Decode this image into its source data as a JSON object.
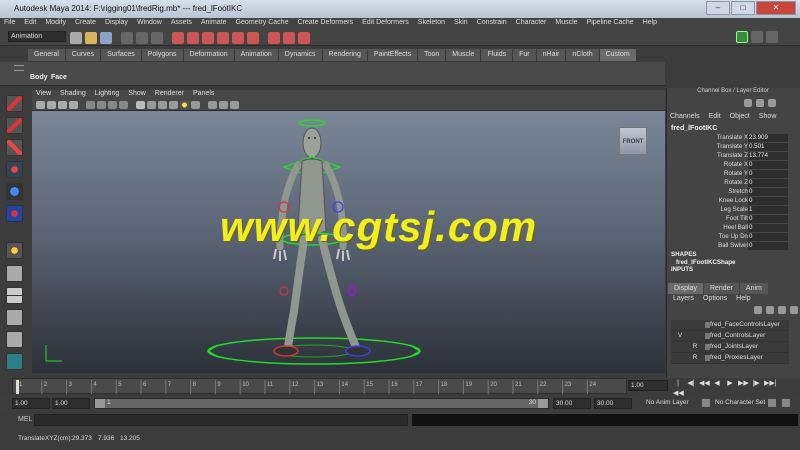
{
  "window": {
    "title": "Autodesk Maya 2014: F:\\rigging01\\fredRig.mb* --- fred_lFootIKC",
    "minimize": "–",
    "maximize": "□",
    "close": "✕"
  },
  "menu": [
    "File",
    "Edit",
    "Modify",
    "Create",
    "Display",
    "Window",
    "Assets",
    "Animate",
    "Geometry Cache",
    "Create Deformers",
    "Edit Deformers",
    "Skeleton",
    "Skin",
    "Constrain",
    "Character",
    "Muscle",
    "Pipeline Cache",
    "Help"
  ],
  "status_line": {
    "mode": "Animation"
  },
  "shelf_tabs": [
    "General",
    "Curves",
    "Surfaces",
    "Polygons",
    "Deformation",
    "Animation",
    "Dynamics",
    "Rendering",
    "PaintEffects",
    "Toon",
    "Muscle",
    "Fluids",
    "Fur",
    "nHair",
    "nCloth",
    "Custom"
  ],
  "shelf_active": "Custom",
  "shelf_items": [
    "Body",
    "Face"
  ],
  "panel_menu": [
    "View",
    "Shading",
    "Lighting",
    "Show",
    "Renderer",
    "Panels"
  ],
  "viewport": {
    "camera_label": "FRONT",
    "watermark": "www.cgtsj.com"
  },
  "channel_box": {
    "title": "Channel Box / Layer Editor",
    "menu": [
      "Channels",
      "Edit",
      "Object",
      "Show"
    ],
    "object": "fred_lFootIKC",
    "attributes": [
      {
        "name": "Translate X",
        "value": "23.909"
      },
      {
        "name": "Translate Y",
        "value": "0.501"
      },
      {
        "name": "Translate Z",
        "value": "13.774"
      },
      {
        "name": "Rotate X",
        "value": "0"
      },
      {
        "name": "Rotate Y",
        "value": "0"
      },
      {
        "name": "Rotate Z",
        "value": "0"
      },
      {
        "name": "Stretch",
        "value": "0"
      },
      {
        "name": "Knee Lock",
        "value": "0"
      },
      {
        "name": "Leg Scale",
        "value": "1"
      },
      {
        "name": "Foot Tilt",
        "value": "0"
      },
      {
        "name": "Heel Ball",
        "value": "0"
      },
      {
        "name": "Toe Up Dn",
        "value": "0"
      },
      {
        "name": "Ball Swivel",
        "value": "0"
      }
    ],
    "shapes_header": "SHAPES",
    "shape_name": "fred_lFootIKCShape",
    "inputs_header": "INPUTS"
  },
  "layer_editor": {
    "tabs": [
      "Display",
      "Render",
      "Anim"
    ],
    "menu": [
      "Layers",
      "Options",
      "Help"
    ],
    "layers": [
      {
        "vis": "",
        "ref": "",
        "name": "fred_FaceControlsLayer"
      },
      {
        "vis": "V",
        "ref": "",
        "name": "fred_ControlsLayer"
      },
      {
        "vis": "",
        "ref": "R",
        "name": "fred_JointsLayer"
      },
      {
        "vis": "",
        "ref": "R",
        "name": "fred_ProxiesLayer"
      }
    ]
  },
  "timeline": {
    "ticks": [
      "1",
      "2",
      "3",
      "4",
      "5",
      "6",
      "7",
      "8",
      "9",
      "10",
      "11",
      "12",
      "13",
      "14",
      "15",
      "16",
      "17",
      "18",
      "19",
      "20",
      "21",
      "22",
      "23",
      "24"
    ],
    "current_frame": "1.00",
    "playback_buttons": [
      "|◀◀",
      "◀|",
      "◀◀",
      "◀",
      "▶",
      "▶▶",
      "|▶",
      "▶▶|"
    ]
  },
  "range": {
    "start": "1.00",
    "playback_start": "1.00",
    "slider_start": "1",
    "slider_end": "30",
    "playback_end": "30.00",
    "end": "30.00",
    "anim_layer": "No Anim Layer",
    "character_set": "No Character Set"
  },
  "mel": {
    "label": "MEL"
  },
  "help_line": {
    "label": "TranslateXYZ(cm):",
    "x": "29.373",
    "y": "7.936",
    "z": "13.205"
  },
  "colors": {
    "manipulator": "#22dd22",
    "watermark": "#f3ef1e",
    "control_blue": "#3344ee",
    "control_red": "#dd3333"
  }
}
